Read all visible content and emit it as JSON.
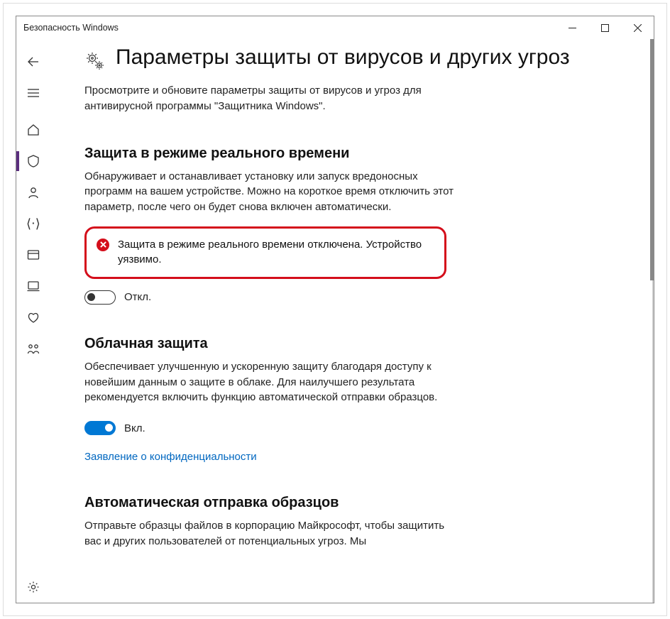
{
  "window": {
    "title": "Безопасность Windows"
  },
  "page": {
    "title": "Параметры защиты от вирусов и других угроз",
    "description": "Просмотрите и обновите параметры защиты от вирусов и угроз для антивирусной программы \"Защитника Windows\"."
  },
  "realtime": {
    "heading": "Защита в режиме реального времени",
    "description": "Обнаруживает и останавливает установку или запуск вредоносных программ на вашем устройстве. Можно на короткое время отключить этот параметр, после чего он будет снова включен автоматически.",
    "alert": "Защита в режиме реального времени отключена. Устройство уязвимо.",
    "toggle_label": "Откл."
  },
  "cloud": {
    "heading": "Облачная защита",
    "description": "Обеспечивает улучшенную и ускоренную защиту благодаря доступу к новейшим данным о защите в облаке. Для наилучшего результата рекомендуется включить функцию автоматической отправки образцов.",
    "toggle_label": "Вкл.",
    "privacy_link": "Заявление о конфиденциальности"
  },
  "samples": {
    "heading": "Автоматическая отправка образцов",
    "description": "Отправьте образцы файлов в корпорацию Майкрософт, чтобы защитить вас и других пользователей от потенциальных угроз. Мы"
  }
}
